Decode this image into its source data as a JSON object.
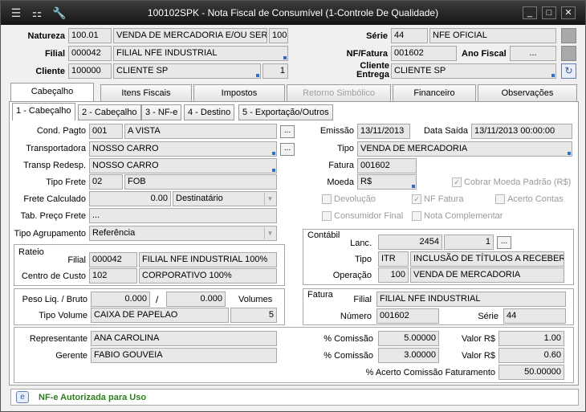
{
  "window": {
    "title": "100102SPK - Nota Fiscal de Consumível (1-Controle De Qualidade)"
  },
  "header": {
    "natureza_label": "Natureza",
    "natureza_code": "100.01",
    "natureza_desc": "VENDA DE MERCADORIA E/OU SERVI",
    "natureza_num": "100",
    "filial_label": "Filial",
    "filial_code": "000042",
    "filial_desc": "FILIAL NFE INDUSTRIAL",
    "cliente_label": "Cliente",
    "cliente_code": "100000",
    "cliente_desc": "CLIENTE SP",
    "cliente_num": "1",
    "serie_label": "Série",
    "serie_code": "44",
    "serie_desc": "NFE OFICIAL",
    "nf_label": "NF/Fatura",
    "nf_value": "001602",
    "ano_label": "Ano Fiscal",
    "ano_value": "...",
    "cliente_entrega_label1": "Cliente",
    "cliente_entrega_label2": "Entrega",
    "cliente_entrega_value": "CLIENTE SP"
  },
  "tabs": [
    "Cabeçalho",
    "Itens Fiscais",
    "Impostos",
    "Retorno Simbólico",
    "Financeiro",
    "Observações"
  ],
  "subtabs": [
    "1 - Cabeçalho",
    "2 - Cabeçalho",
    "3 - NF-e",
    "4 - Destino",
    "5 - Exportação/Outros"
  ],
  "form": {
    "cond_label": "Cond. Pagto",
    "cond_code": "001",
    "cond_desc": "A VISTA",
    "transp_label": "Transportadora",
    "transp_value": "NOSSO CARRO",
    "redesp_label": "Transp Redesp.",
    "redesp_value": "NOSSO CARRO",
    "frete_label": "Tipo Frete",
    "frete_code": "02",
    "frete_desc": "FOB",
    "frete_calc_label": "Frete Calculado",
    "frete_calc_value": "0.00",
    "frete_calc_select": "Destinatário",
    "tab_preco_label": "Tab. Preço Frete",
    "tab_preco_value": "...",
    "tipo_agrup_label": "Tipo Agrupamento",
    "tipo_agrup_value": "Referência",
    "emissao_label": "Emissão",
    "emissao_value": "13/11/2013",
    "saida_label": "Data Saída",
    "saida_value": "13/11/2013 00:00:00",
    "tipo_label": "Tipo",
    "tipo_value": "VENDA DE MERCADORIA",
    "fatura_label": "Fatura",
    "fatura_value": "001602",
    "moeda_label": "Moeda",
    "moeda_value": "R$",
    "cobrar_label": "Cobrar Moeda Padrão (R$)",
    "devolucao_label": "Devolução",
    "nf_fatura_label": "NF Fatura",
    "acerto_label": "Acerto Contas",
    "consumidor_label": "Consumidor Final",
    "complementar_label": "Nota Complementar"
  },
  "rateio": {
    "title": "Rateio",
    "filial_label": "Filial",
    "filial_code": "000042",
    "filial_desc": "FILIAL NFE INDUSTRIAL 100%",
    "cc_label": "Centro de Custo",
    "cc_code": "102",
    "cc_desc": "CORPORATIVO 100%"
  },
  "contabil": {
    "title": "Contábil",
    "lanc_label": "Lanc.",
    "lanc_value": "2454",
    "lanc_num": "1",
    "tipo_label": "Tipo",
    "tipo_code": "ITR",
    "tipo_desc": "INCLUSÃO DE TÍTULOS A RECEBER",
    "op_label": "Operação",
    "op_code": "100",
    "op_desc": "VENDA DE MERCADORIA"
  },
  "peso": {
    "label": "Peso Liq. / Bruto",
    "liq": "0.000",
    "sep": "/",
    "bruto": "0.000",
    "volumes_label": "Volumes",
    "tipo_vol_label": "Tipo Volume",
    "tipo_vol_value": "CAIXA DE PAPELAO",
    "volumes_value": "5"
  },
  "fatura_grp": {
    "title": "Fatura",
    "filial_label": "Filial",
    "filial_value": "FILIAL NFE INDUSTRIAL",
    "numero_label": "Número",
    "numero_value": "001602",
    "serie_label": "Série",
    "serie_value": "44"
  },
  "comissao": {
    "rep_label": "Representante",
    "rep_value": "ANA CAROLINA",
    "ger_label": "Gerente",
    "ger_value": "FABIO GOUVEIA",
    "pc_label": "% Comissão",
    "pc1": "5.00000",
    "pc2": "3.00000",
    "valor_label": "Valor R$",
    "v1": "1.00",
    "v2": "0.60",
    "acerto_label": "% Acerto Comissão Faturamento",
    "acerto_value": "50.00000"
  },
  "status": {
    "text": "NF-e Autorizada para Uso"
  },
  "colors": {
    "status_text": "#2e7d1f",
    "titlebar": "#1e1e1e",
    "dot": "#2f6fc9"
  }
}
